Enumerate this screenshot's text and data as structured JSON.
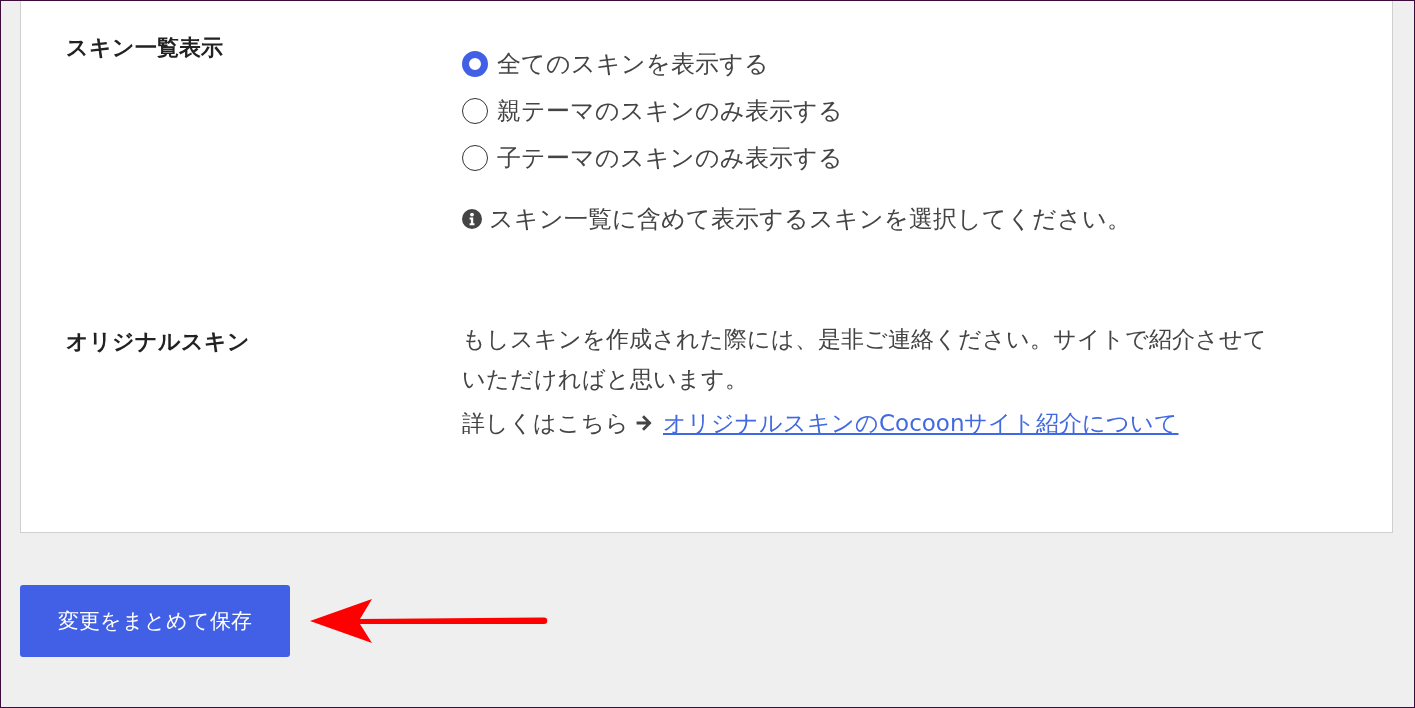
{
  "sections": [
    {
      "kind": "radio_group",
      "label": "スキン一覧表示",
      "options": [
        {
          "label": "全てのスキンを表示する",
          "selected": true
        },
        {
          "label": "親テーマのスキンのみ表示する",
          "selected": false
        },
        {
          "label": "子テーマのスキンのみ表示する",
          "selected": false
        }
      ],
      "note": "スキン一覧に含めて表示するスキンを選択してください。"
    },
    {
      "kind": "text",
      "label": "オリジナルスキン",
      "paragraph": "もしスキンを作成された際には、是非ご連絡ください。サイトで紹介させていただければと思います。",
      "more_label": "詳しくはこちら",
      "link": "オリジナルスキンのCocoonサイト紹介について"
    }
  ],
  "save_button": {
    "label": "変更をまとめて保存"
  }
}
